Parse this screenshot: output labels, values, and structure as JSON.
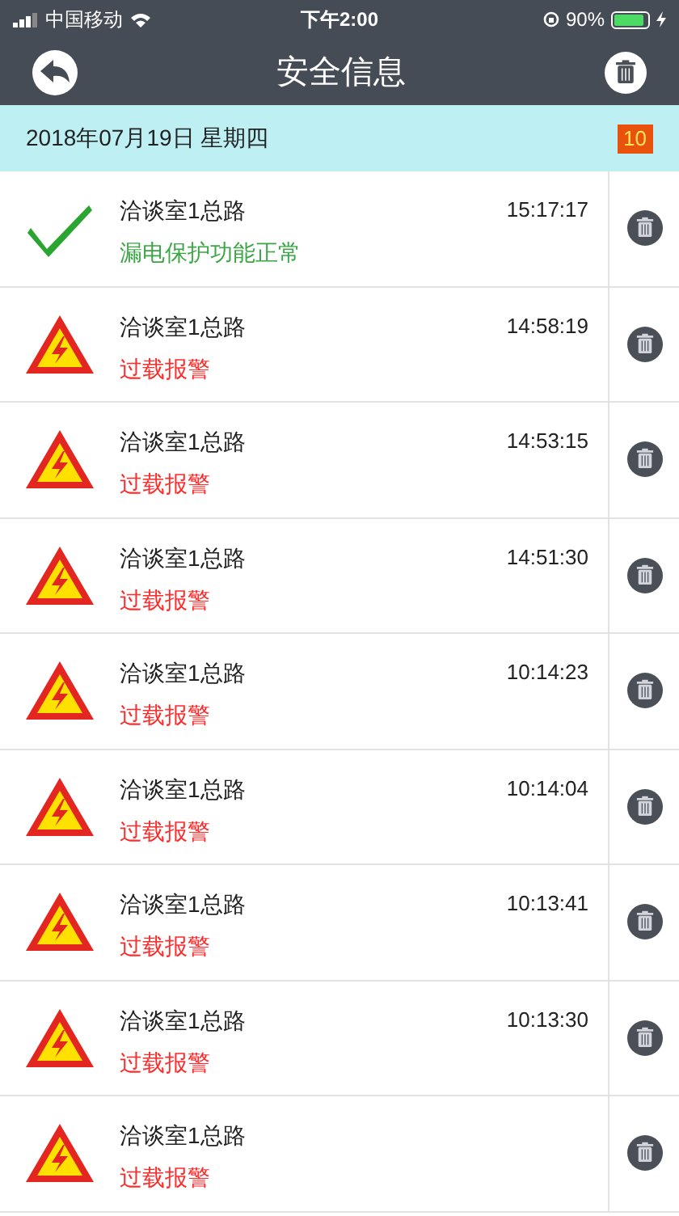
{
  "status_bar": {
    "carrier": "中国移动",
    "time": "下午2:00",
    "battery": "90%"
  },
  "nav": {
    "title": "安全信息"
  },
  "date_bar": {
    "date": "2018年07月19日 星期四",
    "count": "10"
  },
  "events": [
    {
      "kind": "ok",
      "location": "洽谈室1总路",
      "message": "漏电保护功能正常",
      "time": "15:17:17"
    },
    {
      "kind": "alarm",
      "location": "洽谈室1总路",
      "message": "过载报警",
      "time": "14:58:19"
    },
    {
      "kind": "alarm",
      "location": "洽谈室1总路",
      "message": "过载报警",
      "time": "14:53:15"
    },
    {
      "kind": "alarm",
      "location": "洽谈室1总路",
      "message": "过载报警",
      "time": "14:51:30"
    },
    {
      "kind": "alarm",
      "location": "洽谈室1总路",
      "message": "过载报警",
      "time": "10:14:23"
    },
    {
      "kind": "alarm",
      "location": "洽谈室1总路",
      "message": "过载报警",
      "time": "10:14:04"
    },
    {
      "kind": "alarm",
      "location": "洽谈室1总路",
      "message": "过载报警",
      "time": "10:13:41"
    },
    {
      "kind": "alarm",
      "location": "洽谈室1总路",
      "message": "过载报警",
      "time": "10:13:30"
    },
    {
      "kind": "alarm",
      "location": "洽谈室1总路",
      "message": "过载报警"
    }
  ]
}
